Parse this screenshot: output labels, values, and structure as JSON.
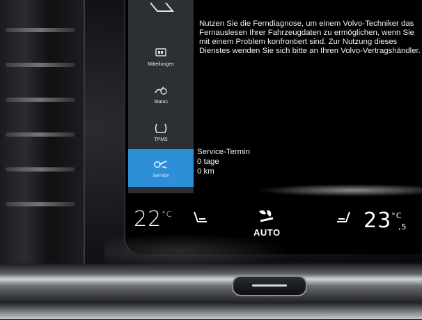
{
  "sidebar": {
    "items": [
      {
        "label": "Mitteilungen",
        "icon": "messages-icon"
      },
      {
        "label": "Status",
        "icon": "status-icon"
      },
      {
        "label": "TPMS",
        "icon": "tire-pressure-icon"
      },
      {
        "label": "Service",
        "icon": "service-wrench-icon",
        "active": true
      }
    ]
  },
  "main": {
    "info_text": "Nutzen Sie die Ferndiagnose, um einem Volvo-Techniker das Fernauslesen Ihrer Fahrzeugdaten zu ermöglichen, wenn Sie mit einem Problem konfrontiert sind. Zur Nutzung dieses Dienstes wenden Sie sich bitte an Ihren Volvo-Vertragshändler.",
    "service": {
      "title": "Service-Termin",
      "days": "0 tage",
      "distance": "0 km"
    }
  },
  "climate": {
    "left_temp": "22",
    "left_unit": "°C",
    "right_temp": "23",
    "right_unit": "°C",
    "right_decimal": ",5",
    "fan_mode": "AUTO"
  },
  "colors": {
    "sidebar_bg": "#2b3035",
    "active_item": "#2d8fd8",
    "screen_bg": "#000000",
    "text": "#f1f1f1"
  }
}
